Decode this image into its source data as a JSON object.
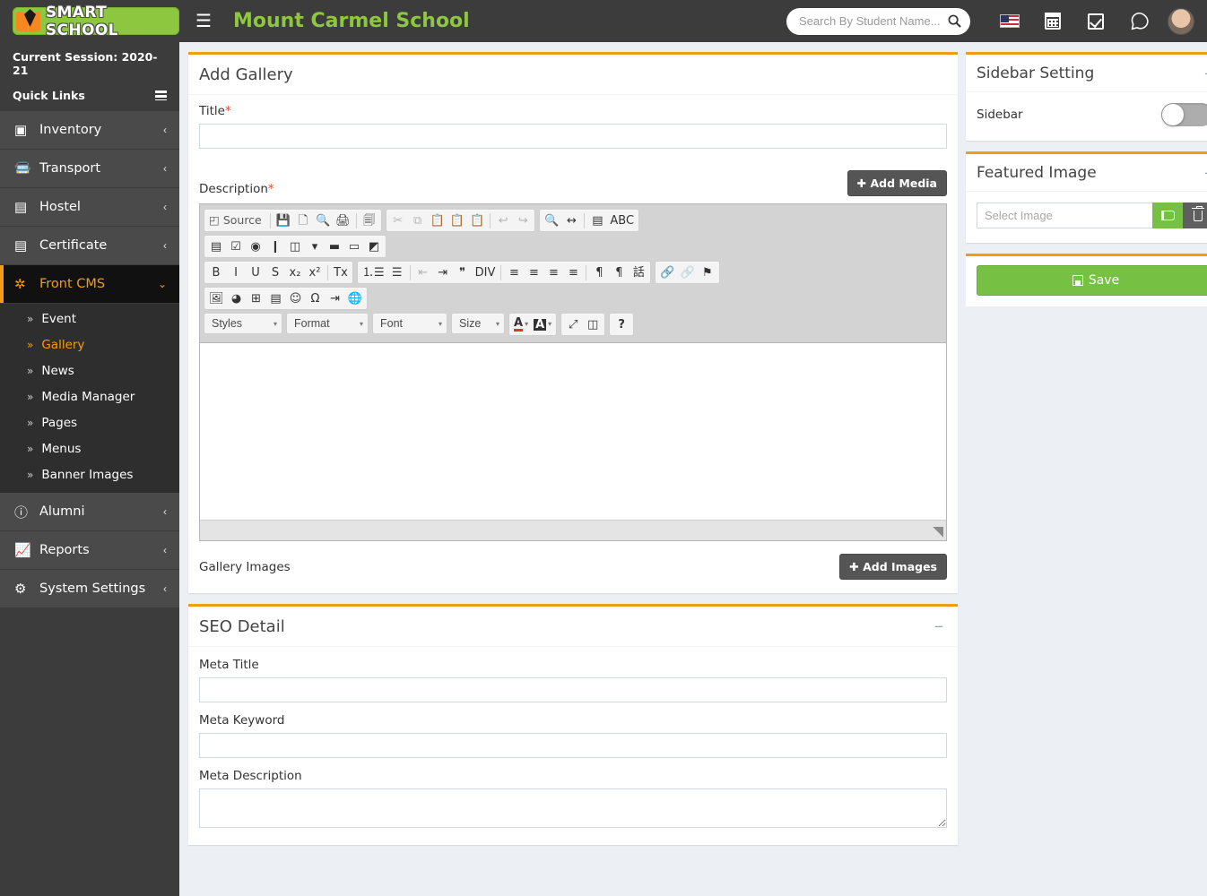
{
  "header": {
    "logo_text": "SMART SCHOOL",
    "hamburger": "☰",
    "school_name": "Mount Carmel School",
    "search_placeholder": "Search By Student Name...",
    "search_value": "",
    "icons": [
      "flag-usa-icon",
      "calendar-icon",
      "checkbox-icon",
      "whatsapp-icon",
      "avatar"
    ]
  },
  "sidebar": {
    "session_label": "Current Session: 2020-21",
    "quick_links_label": "Quick Links",
    "items": [
      {
        "label": "Inventory",
        "icon": "inventory-icon",
        "glyph": "▣",
        "arrow": "‹",
        "active": false
      },
      {
        "label": "Transport",
        "icon": "bus-icon",
        "glyph": "🚍",
        "arrow": "‹",
        "active": false
      },
      {
        "label": "Hostel",
        "icon": "building-icon",
        "glyph": "▤",
        "arrow": "‹",
        "active": false
      },
      {
        "label": "Certificate",
        "icon": "certificate-icon",
        "glyph": "▤",
        "arrow": "‹",
        "active": false
      },
      {
        "label": "Front CMS",
        "icon": "asterisk-circle-icon",
        "glyph": "✲",
        "arrow": "⌄",
        "active": true
      }
    ],
    "submenu": [
      {
        "label": "Event",
        "current": false
      },
      {
        "label": "Gallery",
        "current": true
      },
      {
        "label": "News",
        "current": false
      },
      {
        "label": "Media Manager",
        "current": false
      },
      {
        "label": "Pages",
        "current": false
      },
      {
        "label": "Menus",
        "current": false
      },
      {
        "label": "Banner Images",
        "current": false
      }
    ],
    "items_after": [
      {
        "label": "Alumni",
        "icon": "info-circle-icon",
        "glyph": "ⓘ",
        "arrow": "‹"
      },
      {
        "label": "Reports",
        "icon": "chart-line-icon",
        "glyph": "📈",
        "arrow": "‹"
      },
      {
        "label": "System Settings",
        "icon": "gears-icon",
        "glyph": "⚙",
        "arrow": "‹"
      }
    ]
  },
  "main": {
    "page_title": "Add Gallery",
    "title_label": "Title",
    "title_required": "*",
    "title_value": "",
    "description_label": "Description",
    "description_required": "*",
    "add_media_label": "Add Media",
    "add_media_plus": "✚",
    "gallery_images_label": "Gallery Images",
    "add_images_label": "Add Images",
    "add_images_plus": "✚",
    "editor_content": ""
  },
  "editor": {
    "row1_group1": [
      {
        "name": "source-button",
        "glyph": "◰",
        "label": "Source",
        "disabled": false
      },
      {
        "name": "save-button",
        "glyph": "💾",
        "label": "",
        "disabled": false
      },
      {
        "name": "new-page-button",
        "glyph": "🗋",
        "label": "",
        "disabled": false
      },
      {
        "name": "preview-button",
        "glyph": "🔍",
        "label": "",
        "disabled": false
      },
      {
        "name": "print-button",
        "glyph": "🖨",
        "label": "",
        "disabled": false
      },
      {
        "name": "templates-button",
        "glyph": "🗐",
        "label": "",
        "disabled": false
      }
    ],
    "row1_group2": [
      {
        "name": "cut-button",
        "glyph": "✂",
        "disabled": true
      },
      {
        "name": "copy-button",
        "glyph": "⧉",
        "disabled": true
      },
      {
        "name": "paste-button",
        "glyph": "📋",
        "disabled": false
      },
      {
        "name": "paste-text-button",
        "glyph": "📋",
        "disabled": false
      },
      {
        "name": "paste-word-button",
        "glyph": "📋",
        "disabled": false
      },
      {
        "name": "undo-button",
        "glyph": "↩",
        "disabled": true
      },
      {
        "name": "redo-button",
        "glyph": "↪",
        "disabled": true
      }
    ],
    "row1_group3": [
      {
        "name": "find-button",
        "glyph": "🔍",
        "disabled": false
      },
      {
        "name": "replace-button",
        "glyph": "↔",
        "disabled": false
      },
      {
        "name": "select-all-button",
        "glyph": "▤",
        "disabled": false
      },
      {
        "name": "spellcheck-button",
        "glyph": "ABC",
        "disabled": false
      }
    ],
    "row2_group": [
      {
        "name": "form-button",
        "glyph": "▤"
      },
      {
        "name": "checkbox-button",
        "glyph": "☑"
      },
      {
        "name": "radio-button",
        "glyph": "◉"
      },
      {
        "name": "textfield-button",
        "glyph": "❙"
      },
      {
        "name": "textarea-button",
        "glyph": "◫"
      },
      {
        "name": "select-field-button",
        "glyph": "▾"
      },
      {
        "name": "button-field-button",
        "glyph": "▬"
      },
      {
        "name": "image-button-button",
        "glyph": "▭"
      },
      {
        "name": "hidden-field-button",
        "glyph": "◩"
      }
    ],
    "row3_group1": [
      {
        "name": "bold-button",
        "glyph": "B"
      },
      {
        "name": "italic-button",
        "glyph": "I"
      },
      {
        "name": "underline-button",
        "glyph": "U"
      },
      {
        "name": "strike-button",
        "glyph": "S"
      },
      {
        "name": "subscript-button",
        "glyph": "x₂"
      },
      {
        "name": "superscript-button",
        "glyph": "x²"
      },
      {
        "name": "remove-format-button",
        "glyph": "Tx"
      }
    ],
    "row3_group2": [
      {
        "name": "numbered-list-button",
        "glyph": "⒈☰",
        "disabled": false
      },
      {
        "name": "bulleted-list-button",
        "glyph": "☰",
        "disabled": false
      },
      {
        "name": "outdent-button",
        "glyph": "⇤",
        "disabled": true
      },
      {
        "name": "indent-button",
        "glyph": "⇥",
        "disabled": false
      },
      {
        "name": "blockquote-button",
        "glyph": "❞",
        "disabled": false
      },
      {
        "name": "create-div-button",
        "glyph": "DIV",
        "disabled": false
      },
      {
        "name": "align-left-button",
        "glyph": "≡",
        "disabled": false
      },
      {
        "name": "align-center-button",
        "glyph": "≡",
        "disabled": false
      },
      {
        "name": "align-right-button",
        "glyph": "≡",
        "disabled": false
      },
      {
        "name": "align-justify-button",
        "glyph": "≡",
        "disabled": false
      },
      {
        "name": "ltr-button",
        "glyph": "¶",
        "disabled": false
      },
      {
        "name": "rtl-button",
        "glyph": "¶",
        "disabled": false
      },
      {
        "name": "language-button",
        "glyph": "話",
        "disabled": false
      }
    ],
    "row3_group3": [
      {
        "name": "link-button",
        "glyph": "🔗",
        "disabled": false
      },
      {
        "name": "unlink-button",
        "glyph": "🔗",
        "disabled": true
      },
      {
        "name": "anchor-button",
        "glyph": "⚑",
        "disabled": false
      }
    ],
    "row4_group": [
      {
        "name": "image-button",
        "glyph": "🖼"
      },
      {
        "name": "flash-button",
        "glyph": "◕"
      },
      {
        "name": "table-button",
        "glyph": "⊞"
      },
      {
        "name": "horizontal-rule-button",
        "glyph": "▤"
      },
      {
        "name": "smiley-button",
        "glyph": "☺"
      },
      {
        "name": "special-char-button",
        "glyph": "Ω"
      },
      {
        "name": "page-break-button",
        "glyph": "⇥"
      },
      {
        "name": "iframe-button",
        "glyph": "🌐"
      }
    ],
    "combos": [
      {
        "name": "styles-combo",
        "label": "Styles"
      },
      {
        "name": "format-combo",
        "label": "Format"
      },
      {
        "name": "font-combo",
        "label": "Font"
      },
      {
        "name": "size-combo",
        "label": "Size"
      }
    ],
    "row5_extra": [
      {
        "name": "text-color-button",
        "glyph": "A"
      },
      {
        "name": "bg-color-button",
        "glyph": "A"
      },
      {
        "name": "maximize-button",
        "glyph": "⤢"
      },
      {
        "name": "show-blocks-button",
        "glyph": "◫"
      },
      {
        "name": "about-button",
        "glyph": "?"
      }
    ],
    "caret": "▾"
  },
  "seo": {
    "section_title": "SEO Detail",
    "meta_title_label": "Meta Title",
    "meta_title_value": "",
    "meta_keyword_label": "Meta Keyword",
    "meta_keyword_value": "",
    "meta_description_label": "Meta Description",
    "meta_description_value": ""
  },
  "right": {
    "sidebar_setting_title": "Sidebar Setting",
    "sidebar_label": "Sidebar",
    "sidebar_toggle_on": false,
    "featured_image_title": "Featured Image",
    "select_image_placeholder": "Select Image",
    "select_image_value": "",
    "browse_icon": "folder-open-icon",
    "delete_icon": "trash-icon",
    "save_label": "Save",
    "collapse_glyph": "−"
  },
  "colors": {
    "accent_orange": "#f39c12",
    "brand_green": "#8dc63f",
    "sidebar_dark": "#3c3c3c",
    "active_black": "#111111",
    "save_green": "#76c043",
    "required_red": "#dd4b39"
  }
}
